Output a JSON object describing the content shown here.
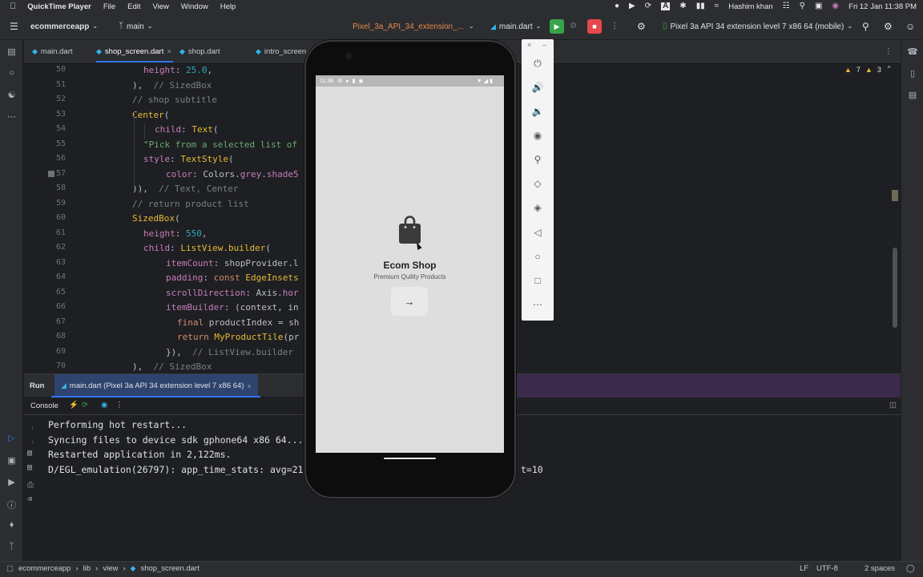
{
  "menubar": {
    "app_name": "QuickTime Player",
    "items": [
      "File",
      "Edit",
      "View",
      "Window",
      "Help"
    ],
    "user": "Hashim khan",
    "datetime": "Fri 12 Jan  11:38 PM"
  },
  "toolbar": {
    "project": "ecommerceapp",
    "branch": "main",
    "device_selector": "Pixel_3a_API_34_extension_...",
    "run_config": "main.dart",
    "device_running": "Pixel 3a API 34 extension level 7 x86 64 (mobile)"
  },
  "tabs": [
    "main.dart",
    "shop_screen.dart",
    "shop.dart",
    "intro_screen"
  ],
  "editor": {
    "warnings": "7",
    "errors": "3",
    "line_numbers": [
      "50",
      "51",
      "52",
      "53",
      "54",
      "55",
      "56",
      "57",
      "58",
      "59",
      "60",
      "61",
      "62",
      "63",
      "64",
      "65",
      "66",
      "67",
      "68",
      "69",
      "70"
    ]
  },
  "run_panel": {
    "run_label": "Run",
    "run_tab": "main.dart (Pixel 3a API 34 extension level 7 x86 64)",
    "console_label": "Console"
  },
  "console": {
    "lines": [
      "Performing hot restart...",
      "Syncing files to device sdk gphone64 x86 64...",
      "Restarted application in 2,122ms.",
      "D/EGL_emulation(26797): app_time_stats: avg=21"
    ],
    "line4_tail": "t=10"
  },
  "statusbar": {
    "breadcrumb": [
      "ecommerceapp",
      "lib",
      "view",
      "shop_screen.dart"
    ],
    "line_ending": "LF",
    "encoding": "UTF-8",
    "indent": "2 spaces"
  },
  "phone": {
    "time": "11:38",
    "app_title": "Ecom Shop",
    "subtitle": "Premium Quility Products"
  },
  "colors": {
    "accent": "#3574f0",
    "run_green": "#36a54a",
    "stop_red": "#e5484d",
    "bg": "#1e1f22",
    "panel": "#2b2d30"
  }
}
